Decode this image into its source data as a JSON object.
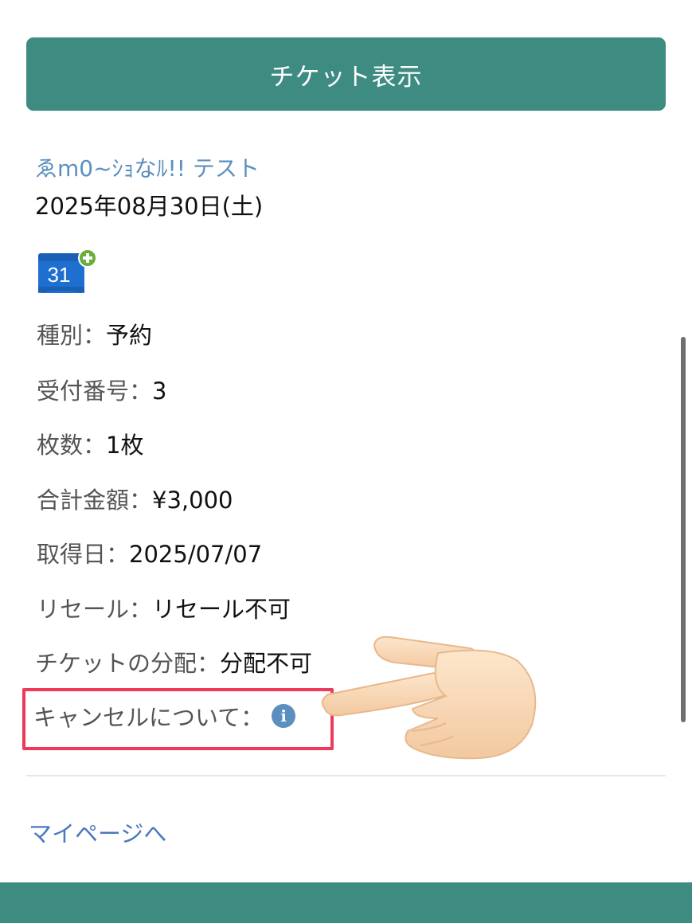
{
  "ticket_button": {
    "label": "チケット表示"
  },
  "event": {
    "title": "ゑm0~ｼｮなﾙ!! テスト",
    "date": "2025年08月30日(土)",
    "calendar_icon": {
      "name": "google-calendar-add-icon",
      "day": "31"
    }
  },
  "details": [
    {
      "label": "種別：",
      "value": "予約"
    },
    {
      "label": "受付番号：",
      "value": "3"
    },
    {
      "label": "枚数：",
      "value": "1枚"
    },
    {
      "label": "合計金額：",
      "value": "¥3,000"
    },
    {
      "label": "取得日：",
      "value": "2025/07/07"
    },
    {
      "label": "リセール：",
      "value": "リセール不可"
    },
    {
      "label": "チケットの分配：",
      "value": "分配不可"
    }
  ],
  "cancel": {
    "label": "キャンセルについて：",
    "icon": "info-icon",
    "icon_glyph": "i"
  },
  "annotation": {
    "highlight_color": "#ee3a5a",
    "pointer": "pointing-hand-icon"
  },
  "mypage_link": {
    "label": "マイページへ"
  },
  "colors": {
    "accent": "#3e8b82",
    "link": "#4b78be",
    "title_link": "#5b8fbf"
  }
}
